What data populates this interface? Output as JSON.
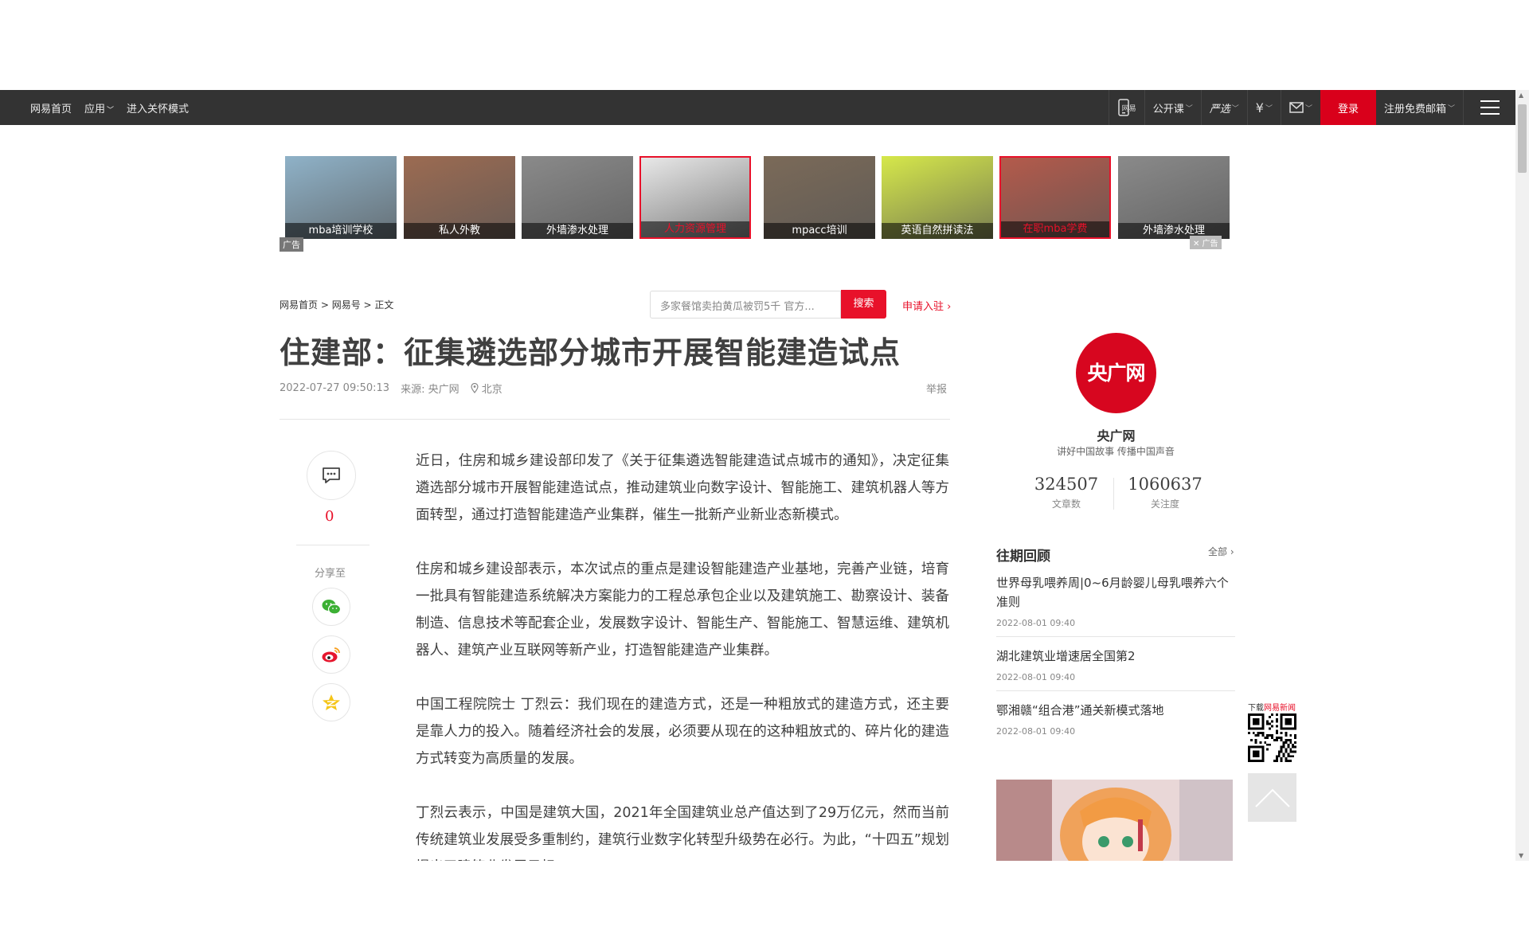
{
  "topbar": {
    "home": "网易首页",
    "apps": "应用",
    "care_mode": "进入关怀模式",
    "mobile_label": "网易",
    "open_course": "公开课",
    "yanxuan": "严选",
    "login": "登录",
    "free_mail": "注册免费邮箱"
  },
  "ads": {
    "mark": "广告",
    "tiles": [
      {
        "label": "mba培训学校",
        "color": "#8fb2c8",
        "highlight": false
      },
      {
        "label": "私人外教",
        "color": "#9c6b52",
        "highlight": false
      },
      {
        "label": "外墙渗水处理",
        "color": "#8a8a8a",
        "highlight": false
      },
      {
        "label": "人力资源管理",
        "color": "#e8e8e8",
        "highlight": true
      },
      {
        "label": "mpacc培训",
        "color": "#7b6a58",
        "highlight": false
      },
      {
        "label": "英语自然拼读法",
        "color": "#d6e84a",
        "highlight": false
      },
      {
        "label": "在职mba学费",
        "color": "#b45a4b",
        "highlight": true
      },
      {
        "label": "外墙渗水处理",
        "color": "#8a8a8a",
        "highlight": false
      }
    ]
  },
  "breadcrumb": {
    "home": "网易首页",
    "sep1": " > ",
    "section": "网易号",
    "sep2": " > ",
    "current": "正文"
  },
  "search": {
    "placeholder": "多家餐馆卖拍黄瓜被罚5千 官方...",
    "button": "搜索",
    "apply": "申请入驻"
  },
  "article": {
    "title": "住建部：征集遴选部分城市开展智能建造试点",
    "time": "2022-07-27 09:50:13",
    "source": "来源: 央广网",
    "location": "北京",
    "report": "举报",
    "comment_count": "0",
    "share_label": "分享至",
    "paragraphs": [
      "近日，住房和城乡建设部印发了《关于征集遴选智能建造试点城市的通知》，决定征集遴选部分城市开展智能建造试点，推动建筑业向数字设计、智能施工、建筑机器人等方面转型，通过打造智能建造产业集群，催生一批新产业新业态新模式。",
      "住房和城乡建设部表示，本次试点的重点是建设智能建造产业基地，完善产业链，培育一批具有智能建造系统解决方案能力的工程总承包企业以及建筑施工、勘察设计、装备制造、信息技术等配套企业，发展数字设计、智能生产、智能施工、智慧运维、建筑机器人、建筑产业互联网等新产业，打造智能建造产业集群。",
      "中国工程院院士 丁烈云：我们现在的建造方式，还是一种粗放式的建造方式，还主要是靠人力的投入。随着经济社会的发展，必须要从现在的这种粗放式的、碎片化的建造方式转变为高质量的发展。",
      "丁烈云表示，中国是建筑大国，2021年全国建筑业总产值达到了29万亿元，然而当前传统建筑业发展受多重制约，建筑行业数字化转型升级势在必行。为此，“十四五”规划提出了建筑业发展目标"
    ]
  },
  "sidebar": {
    "avatar_text": "央广网",
    "name": "央广网",
    "slogan": "讲好中国故事 传播中国声音",
    "articles_count": "324507",
    "articles_label": "文章数",
    "follow_count": "1060637",
    "follow_label": "关注度",
    "review_title": "往期回顾",
    "review_all": "全部",
    "items": [
      {
        "title": "世界母乳喂养周|0~6月龄婴儿母乳喂养六个准则",
        "date": "2022-08-01 09:40"
      },
      {
        "title": "湖北建筑业增速居全国第2",
        "date": "2022-08-01 09:40"
      },
      {
        "title": "鄂湘赣“组合港”通关新模式落地",
        "date": "2022-08-01 09:40"
      }
    ]
  },
  "float": {
    "qr_prefix": "下载",
    "qr_brand": "网易新闻"
  },
  "colors": {
    "brand_red": "#e8112a",
    "topbar_bg": "#333333"
  }
}
